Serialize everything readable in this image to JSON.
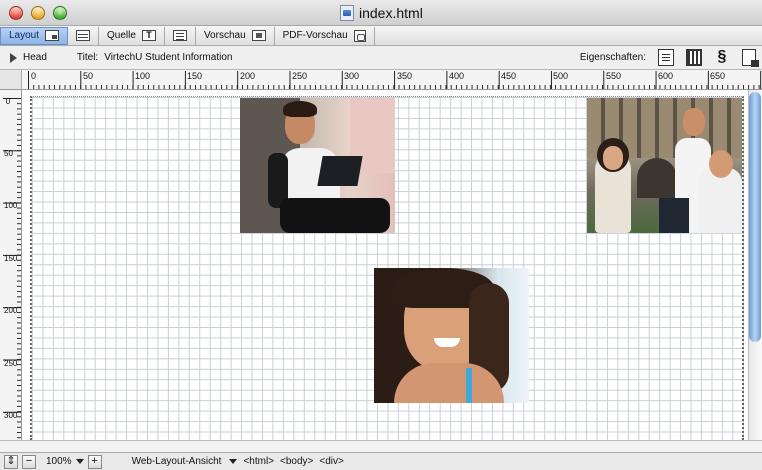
{
  "window": {
    "title": "index.html"
  },
  "viewbar": {
    "tabs": [
      {
        "label": "Layout",
        "icon": "layout-view-icon",
        "active": true
      },
      {
        "label": "",
        "icon": "split-view-icon",
        "active": false
      },
      {
        "label": "Quelle",
        "icon": "source-view-icon",
        "active": false
      },
      {
        "label": "",
        "icon": "text-view-icon",
        "active": false
      },
      {
        "label": "Vorschau",
        "icon": "preview-icon",
        "active": false
      },
      {
        "label": "PDF-Vorschau",
        "icon": "pdf-preview-icon",
        "active": false
      }
    ]
  },
  "headbar": {
    "head_label": "Head",
    "title_label": "Titel:",
    "title_value": "VirtechU Student Information",
    "properties_label": "Eigenschaften:"
  },
  "ruler": {
    "h_labels": [
      "0",
      "50",
      "100",
      "150",
      "200",
      "250",
      "300",
      "350",
      "400",
      "450",
      "500",
      "550",
      "600",
      "650"
    ],
    "v_labels": [
      "0",
      "50",
      "100",
      "150",
      "200",
      "250",
      "300"
    ]
  },
  "statusbar": {
    "zoom": "100%",
    "view_mode": "Web-Layout-Ansicht",
    "tags": [
      "<html>",
      "<body>",
      "<div>"
    ]
  },
  "colors": {
    "active_tab": "#8fb4e6",
    "grid": "#c9cfd9",
    "scroll_thumb": "#6f9bd8"
  }
}
